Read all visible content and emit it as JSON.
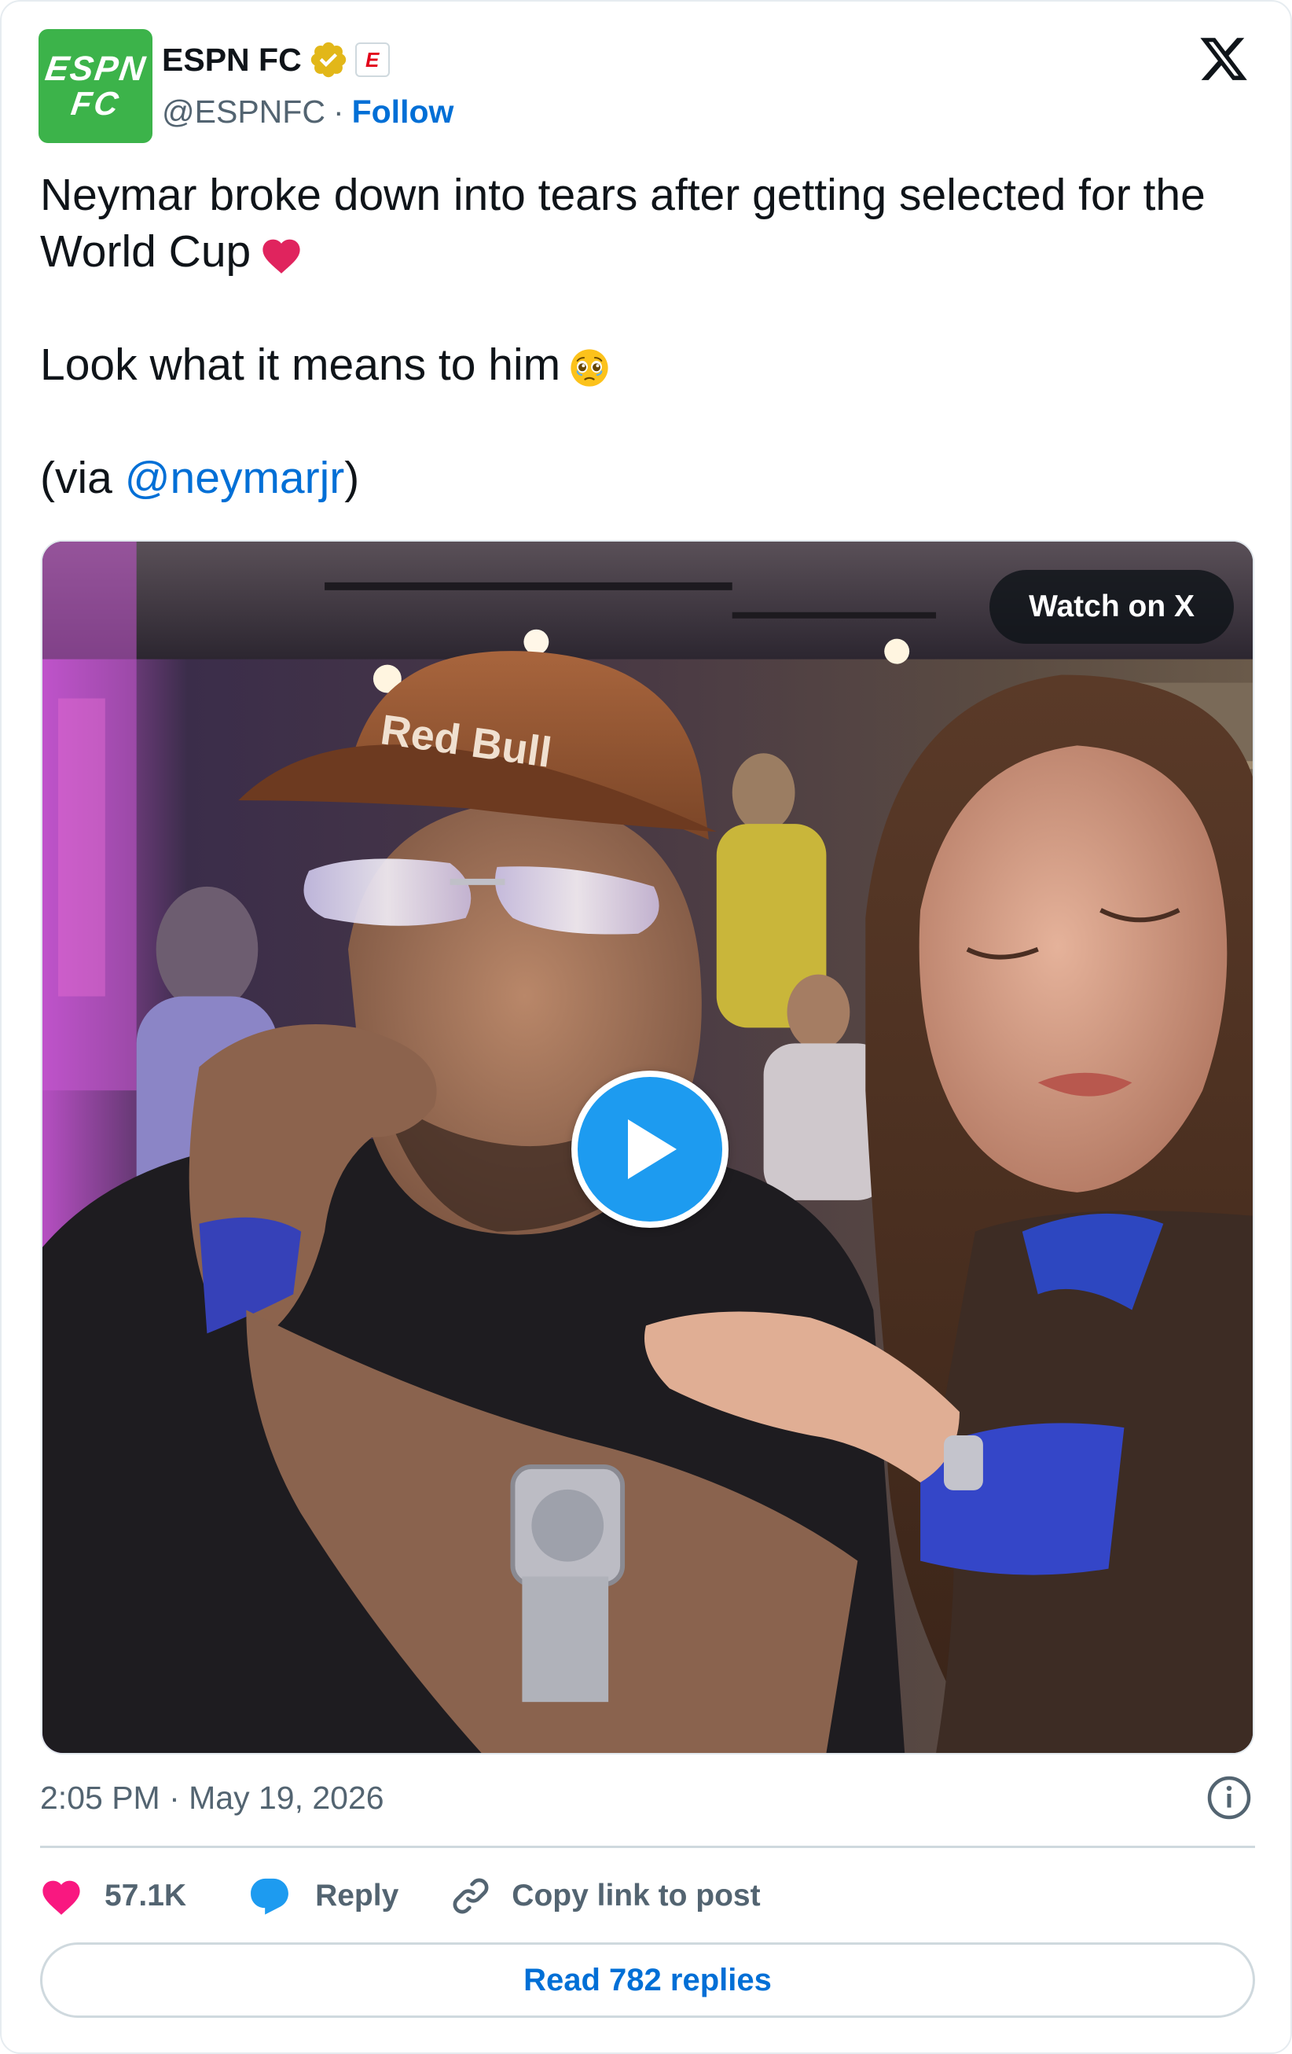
{
  "account": {
    "avatar_line1": "ESPN",
    "avatar_line2": "FC",
    "display_name": "ESPN FC",
    "affiliate_badge": "E",
    "handle": "@ESPNFC",
    "separator": "·",
    "follow_label": "Follow"
  },
  "tweet": {
    "line1": "Neymar broke down into tears after getting selected for the World Cup",
    "line2": "Look what it means to him",
    "via_prefix": "(via ",
    "mention": "@neymarjr",
    "via_suffix": ")"
  },
  "media": {
    "watch_label": "Watch on X",
    "cap_text": "Red Bull"
  },
  "meta": {
    "timestamp": "2:05 PM · May 19, 2026"
  },
  "actions": {
    "likes_count": "57.1K",
    "reply_label": "Reply",
    "copy_label": "Copy link to post",
    "read_replies_label": "Read 782 replies"
  },
  "colors": {
    "avatar_bg": "#3cb34a",
    "link_blue": "#006fd6",
    "play_blue": "#1d9bf0",
    "heart_pink": "#f91880",
    "reply_blue": "#1d9bf0",
    "verified_gold": "#e2b719"
  },
  "icons": {
    "verified": "verified-gold-badge-icon",
    "x_logo": "x-logo-icon",
    "heart": "heart-icon",
    "reply": "reply-bubble-icon",
    "link": "link-icon",
    "info": "info-icon",
    "play": "play-icon"
  }
}
